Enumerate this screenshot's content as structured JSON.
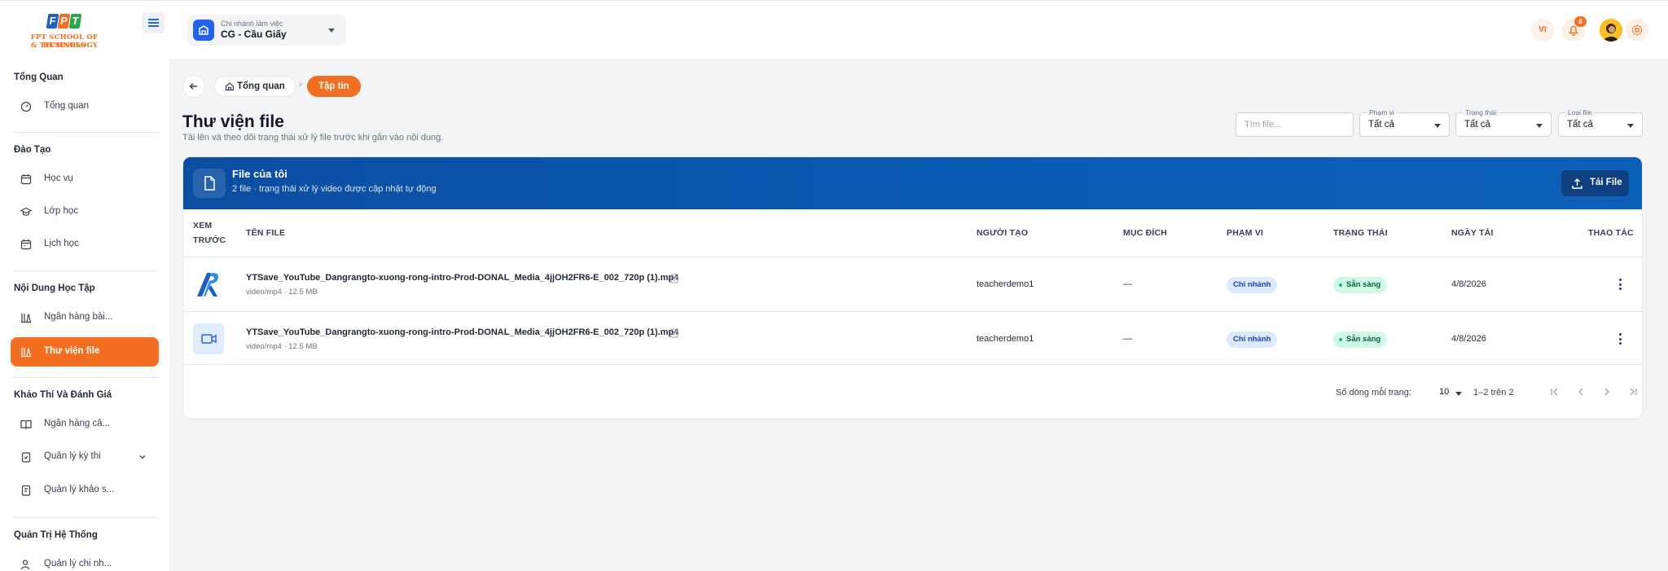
{
  "brand": {
    "logo_top": "FPT",
    "logo_line1": "FPT SCHOOL OF BUSINESS",
    "logo_line2": "& TECHNOLOGY"
  },
  "header": {
    "branch_label": "Chi nhánh làm việc",
    "branch_value": "CG - Cầu Giấy",
    "lang": "VI",
    "notif_count": "8"
  },
  "sidebar": {
    "sections": [
      {
        "title": "Tổng Quan",
        "items": [
          {
            "label": "Tổng quan",
            "icon": "dashboard-icon"
          }
        ]
      },
      {
        "title": "Đào Tạo",
        "items": [
          {
            "label": "Học vụ",
            "icon": "academic-icon"
          },
          {
            "label": "Lớp học",
            "icon": "graduation-cap-icon"
          },
          {
            "label": "Lịch học",
            "icon": "calendar-icon"
          }
        ]
      },
      {
        "title": "Nội Dung Học Tập",
        "items": [
          {
            "label": "Ngân hàng bài...",
            "icon": "library-icon"
          },
          {
            "label": "Thư viện file",
            "icon": "file-library-icon",
            "active": true
          }
        ]
      },
      {
        "title": "Khảo Thí Và Đánh Giá",
        "items": [
          {
            "label": "Ngân hàng câ...",
            "icon": "book-icon"
          },
          {
            "label": "Quản lý kỳ thi",
            "icon": "clipboard-icon"
          },
          {
            "label": "Quản lý khảo s...",
            "icon": "survey-icon"
          }
        ]
      },
      {
        "title": "Quản Trị Hệ Thống",
        "items": [
          {
            "label": "Quản lý chi nh...",
            "icon": "users-icon"
          }
        ]
      }
    ]
  },
  "breadcrumb": {
    "home": "Tổng quan",
    "current": "Tập tin"
  },
  "page": {
    "title": "Thư viện file",
    "subtitle": "Tải lên và theo dõi trạng thái xử lý file trước khi gắn vào nội dung."
  },
  "filters": {
    "search_placeholder": "Tìm file...",
    "scope_label": "Phạm vi",
    "scope_value": "Tất cả",
    "status_label": "Trạng thái",
    "status_value": "Tất cả",
    "type_label": "Loại file",
    "type_value": "Tất cả"
  },
  "card": {
    "title": "File của tôi",
    "subtitle": "2 file · trạng thái xử lý video được cập nhật tự động",
    "upload_label": "Tải File"
  },
  "table": {
    "headers": {
      "preview_1": "XEM",
      "preview_2": "TRƯỚC",
      "name": "TÊN FILE",
      "creator": "NGƯỜI TẠO",
      "purpose": "MỤC ĐÍCH",
      "scope": "PHẠM VI",
      "status": "TRẠNG THÁI",
      "date": "NGÀY TẢI",
      "actions": "THAO TÁC"
    },
    "rows": [
      {
        "preview": "thumbnail",
        "name": "YTSave_YouTube_Dangrangto-xuong-rong-intro-Prod-DONAL_Media_4jjOH2FR6-E_002_720p (1).mp4",
        "meta": "video/mp4 · 12.5 MB",
        "creator": "teacherdemo1",
        "purpose": "—",
        "scope": "Chi nhánh",
        "status": "Sẵn sàng",
        "date": "4/8/2026"
      },
      {
        "preview": "video-icon",
        "name": "YTSave_YouTube_Dangrangto-xuong-rong-intro-Prod-DONAL_Media_4jjOH2FR6-E_002_720p (1).mp4",
        "meta": "video/mp4 · 12.5 MB",
        "creator": "teacherdemo1",
        "purpose": "—",
        "scope": "Chi nhánh",
        "status": "Sẵn sàng",
        "date": "4/8/2026"
      }
    ]
  },
  "pagination": {
    "rows_label": "Số dòng mỗi trang:",
    "rows_value": "10",
    "range": "1–2 trên 2"
  },
  "colors": {
    "accent": "#f26f21",
    "primary_blue": "#0b4ea2",
    "success": "#10b981"
  }
}
